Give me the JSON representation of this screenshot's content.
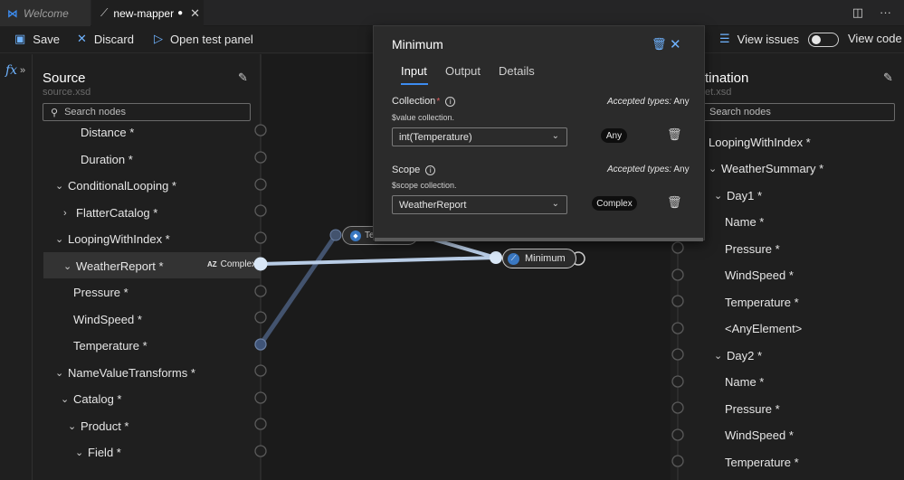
{
  "tabs": {
    "welcome": "Welcome",
    "mapper": "new-mapper",
    "mapper_dirty": "●",
    "close": "✕"
  },
  "toolbar": {
    "save": "Save",
    "discard": "Discard",
    "open_test_panel": "Open test panel",
    "view_issues": "View issues",
    "view_code": "View code",
    "view_code_toggle": false
  },
  "rail": {
    "fx": "fx",
    "chevron": "»"
  },
  "source": {
    "title": "Source",
    "file": "source.xsd",
    "search_placeholder": "Search nodes",
    "nodes": [
      {
        "label": "Distance *",
        "toggle": ""
      },
      {
        "label": "Duration *",
        "toggle": ""
      },
      {
        "label": "ConditionalLooping *",
        "toggle": "⌄"
      },
      {
        "label": "FlatterCatalog *",
        "toggle": "›"
      },
      {
        "label": "LoopingWithIndex *",
        "toggle": "⌄"
      },
      {
        "label": "WeatherReport *",
        "toggle": "⌄"
      },
      {
        "label": "Pressure *",
        "toggle": ""
      },
      {
        "label": "WindSpeed *",
        "toggle": ""
      },
      {
        "label": "Temperature *",
        "toggle": ""
      },
      {
        "label": "NameValueTransforms *",
        "toggle": "⌄"
      },
      {
        "label": "Catalog *",
        "toggle": "⌄"
      },
      {
        "label": "Product *",
        "toggle": "⌄"
      },
      {
        "label": "Field *",
        "toggle": "⌄"
      }
    ],
    "weather_report_type": "Complex",
    "weather_report_type_icon": "AZ"
  },
  "destination": {
    "title": "tination",
    "file": "et.xsd",
    "search_placeholder": "Search nodes",
    "nodes": [
      {
        "label": "LoopingWithIndex *",
        "toggle": ""
      },
      {
        "label": "WeatherSummary *",
        "toggle": "⌄"
      },
      {
        "label": "Day1 *",
        "toggle": "⌄"
      },
      {
        "label": "Name *",
        "toggle": ""
      },
      {
        "label": "Pressure *",
        "toggle": ""
      },
      {
        "label": "WindSpeed *",
        "toggle": ""
      },
      {
        "label": "Temperature *",
        "toggle": ""
      },
      {
        "label": "<AnyElement>",
        "toggle": ""
      },
      {
        "label": "Day2 *",
        "toggle": "⌄"
      },
      {
        "label": "Name *",
        "toggle": ""
      },
      {
        "label": "Pressure *",
        "toggle": ""
      },
      {
        "label": "WindSpeed *",
        "toggle": ""
      },
      {
        "label": "Temperature *",
        "toggle": ""
      }
    ]
  },
  "canvas": {
    "function_node": "Minimum",
    "partial_function_node": "Te"
  },
  "popup": {
    "title": "Minimum",
    "tabs": [
      "Input",
      "Output",
      "Details"
    ],
    "active_tab": "Input",
    "fields": [
      {
        "label": "Collection",
        "required": "*",
        "description": "$value collection.",
        "accepted_label": "Accepted types:",
        "accepted_value": "Any",
        "value": "int(Temperature)",
        "type": "Any"
      },
      {
        "label": "Scope",
        "required": "",
        "description": "$scope collection.",
        "accepted_label": "Accepted types:",
        "accepted_value": "Any",
        "value": "WeatherReport",
        "type": "Complex"
      }
    ]
  },
  "colors": {
    "accent": "#3c8cf0",
    "icon_blue": "#6fb3ff",
    "wire": "#b9cde6"
  }
}
